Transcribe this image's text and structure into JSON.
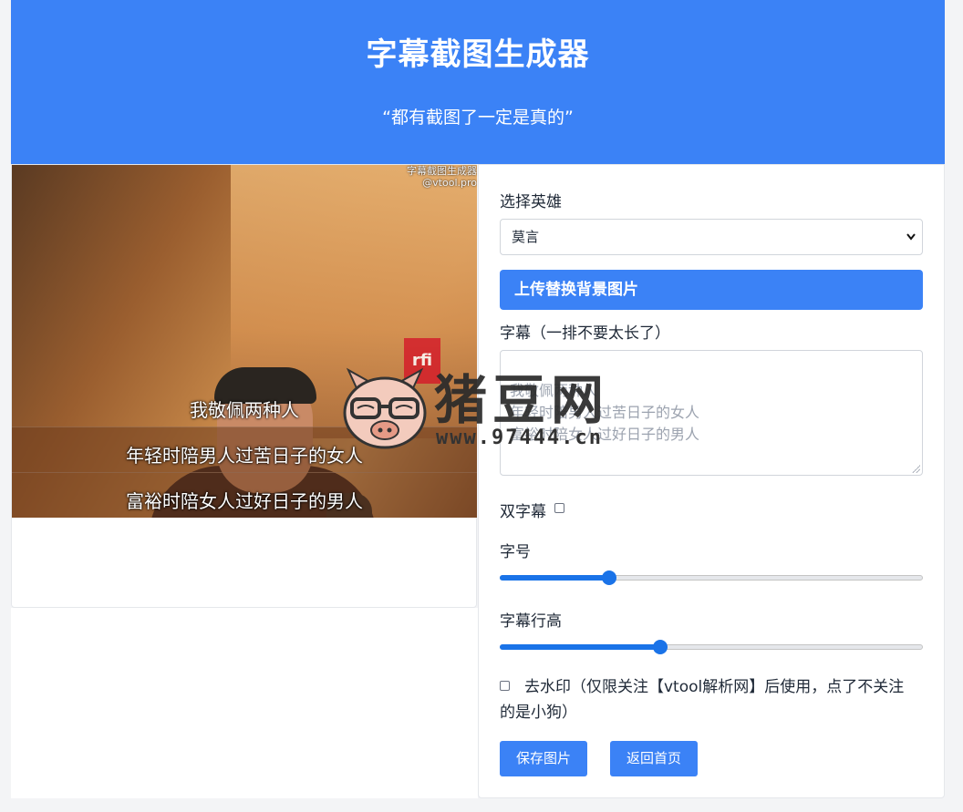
{
  "header": {
    "title": "字幕截图生成器",
    "subtitle": "“都有截图了一定是真的”"
  },
  "preview": {
    "corner_watermark": [
      "字幕截图生成器",
      "@vtool.pro"
    ],
    "subtitles": [
      "我敬佩两种人",
      "年轻时陪男人过苦日子的女人",
      "富裕时陪女人过好日子的男人"
    ]
  },
  "form": {
    "hero_label": "选择英雄",
    "hero_selected": "莫言",
    "upload_label": "上传替换背景图片",
    "subtitle_label": "字幕（一排不要太长了）",
    "subtitle_placeholder": "我敬佩两种人\n年轻时陪男人过苦日子的女人\n富裕时陪女人过好日子的男人",
    "double_subtitle_label": "双字幕",
    "font_size_label": "字号",
    "font_size_value": 0.26,
    "line_height_label": "字幕行高",
    "line_height_value": 0.38,
    "remove_watermark_label": "去水印（仅限关注【vtool解析网】后使用，点了不关注的是小狗）",
    "save_button": "保存图片",
    "home_button": "返回首页"
  },
  "overlay_watermark": {
    "brand": "猪豆网",
    "url": "www.97444.cn"
  },
  "colors": {
    "primary": "#3b82f6",
    "slider": "#1a73e8"
  }
}
